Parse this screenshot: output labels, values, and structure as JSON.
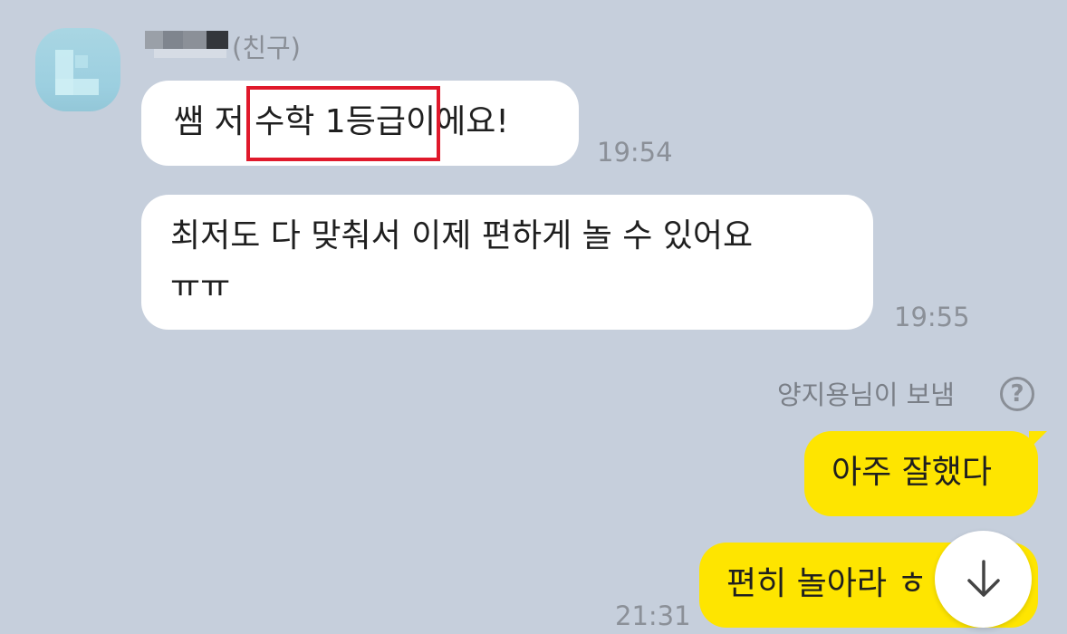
{
  "chat": {
    "sender": {
      "tag": "(친구)",
      "avatar_icon": "avatar-icon"
    },
    "incoming": [
      {
        "text": "쌤 저 수학 1등급이에요!",
        "time": "19:54"
      },
      {
        "lines": [
          "최저도 다 맞춰서 이제 편하게 놀 수 있어요",
          "ㅠㅠ"
        ],
        "time": "19:55"
      }
    ],
    "sent_note": "양지용님이 보냄",
    "help_icon": "question-circle-icon",
    "outgoing": [
      {
        "text": "아주 잘했다"
      },
      {
        "text": "편히 놀아라 ㅎ",
        "time": "21:31"
      }
    ],
    "scroll_icon": "arrow-down-icon"
  },
  "colors": {
    "background": "#c6cfdc",
    "incoming_bubble": "#ffffff",
    "outgoing_bubble": "#fee500",
    "highlight_box": "#e0192b",
    "timestamp": "#8b9098"
  }
}
